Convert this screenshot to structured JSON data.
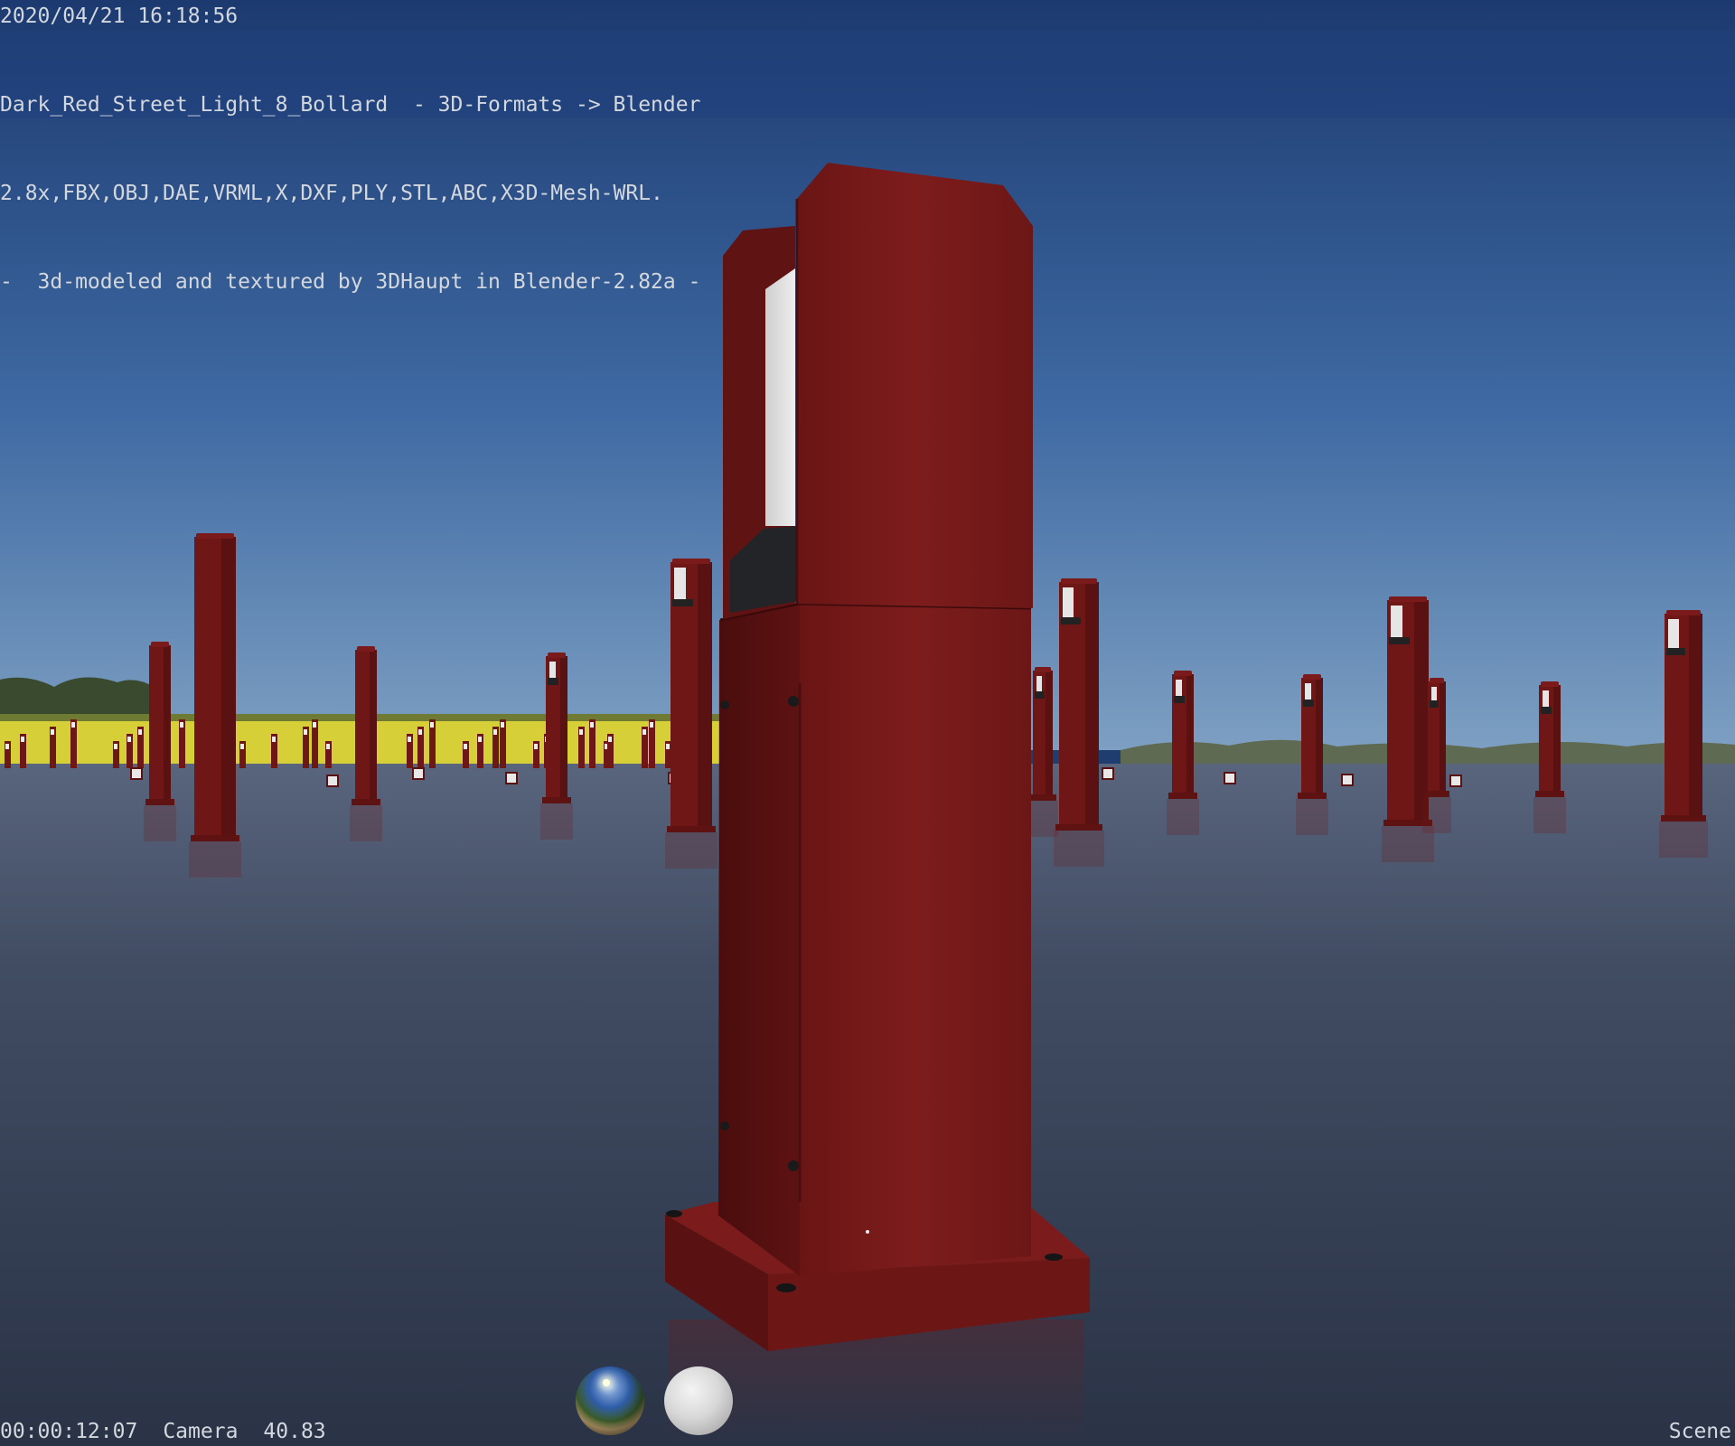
{
  "overlay": {
    "timestamp": "2020/04/21 16:18:56",
    "title_lines": [
      "Dark_Red_Street_Light_8_Bollard  - 3D-Formats -> Blender",
      "2.8x,FBX,OBJ,DAE,VRML,X,DXF,PLY,STL,ABC,X3D-Mesh-WRL.",
      "-  3d-modeled and textured by 3DHaupt in Blender-2.82a -"
    ]
  },
  "footer": {
    "time_code": "00:00:12:07",
    "camera_label": "Camera",
    "lens_value": "40.83",
    "scene_label": "Scene"
  },
  "colors": {
    "sky_top": "#1d3b71",
    "sky_horizon": "#6a8fb3",
    "ground_far": "#55627a",
    "ground_near": "#2b3548",
    "bollard_red": "#7a1a1a",
    "bollard_shadow": "#4c0e0e",
    "field_yellow": "#d9d13a",
    "lamp_white": "#e6e6e6"
  },
  "icons": {
    "hdri_preview": "world-sphere-icon",
    "material_preview": "matte-sphere-icon"
  }
}
